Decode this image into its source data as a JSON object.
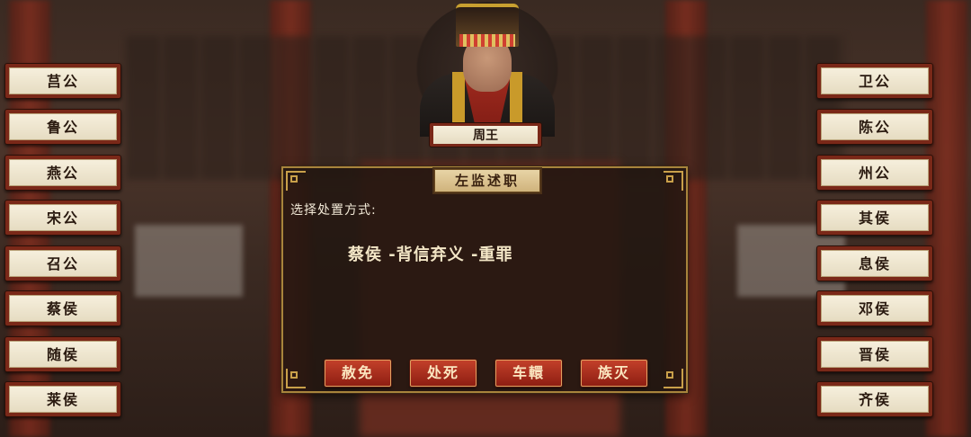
{
  "left_nobles": [
    "莒公",
    "鲁公",
    "燕公",
    "宋公",
    "召公",
    "蔡侯",
    "随侯",
    "莱侯"
  ],
  "right_nobles": [
    "卫公",
    "陈公",
    "州公",
    "其侯",
    "息侯",
    "邓侯",
    "晋侯",
    "齐侯"
  ],
  "portrait": {
    "name": "周王"
  },
  "dialog": {
    "title": "左监述职",
    "prompt": "选择处置方式:",
    "verdict": "蔡侯 -背信弃义 -重罪",
    "buttons": [
      "赦免",
      "处死",
      "车轘",
      "族灭"
    ]
  },
  "colors": {
    "accent_gold": "#a8843c",
    "button_red": "#a62e1c",
    "plaque_frame": "#7a2818"
  }
}
